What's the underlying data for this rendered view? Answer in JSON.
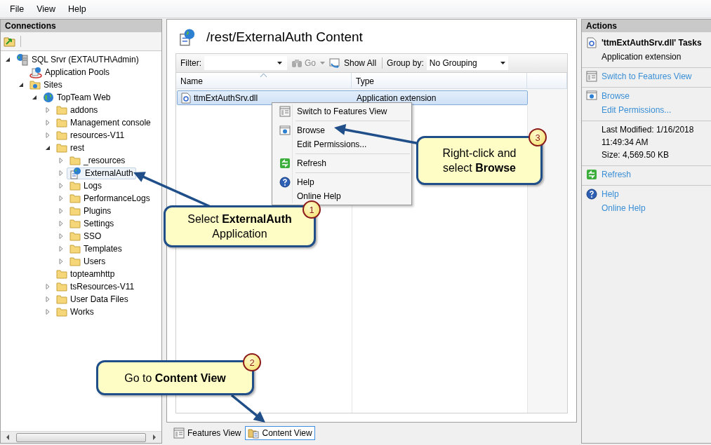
{
  "menu": [
    "File",
    "View",
    "Help"
  ],
  "connections": {
    "title": "Connections",
    "tree": [
      {
        "label": "SQL Srvr (EXTAUTH\\Admin)",
        "kind": "server",
        "expanded": true,
        "selected": false,
        "children": [
          {
            "label": "Application Pools",
            "kind": "pools",
            "selected": false
          },
          {
            "label": "Sites",
            "kind": "sites",
            "expanded": true,
            "selected": false,
            "children": [
              {
                "label": "TopTeam Web",
                "kind": "globe",
                "expanded": true,
                "selected": false,
                "children": [
                  {
                    "label": "addons",
                    "kind": "folder",
                    "expanded": false,
                    "selected": false
                  },
                  {
                    "label": "Management console",
                    "kind": "folder",
                    "expanded": false,
                    "selected": false
                  },
                  {
                    "label": "resources-V11",
                    "kind": "folder",
                    "expanded": false,
                    "selected": false
                  },
                  {
                    "label": "rest",
                    "kind": "folder",
                    "expanded": true,
                    "selected": false,
                    "children": [
                      {
                        "label": "_resources",
                        "kind": "folder",
                        "expanded": false,
                        "selected": false
                      },
                      {
                        "label": "ExternalAuth",
                        "kind": "app",
                        "expanded": false,
                        "selected": true
                      },
                      {
                        "label": "Logs",
                        "kind": "folder",
                        "expanded": false,
                        "selected": false
                      },
                      {
                        "label": "PerformanceLogs",
                        "kind": "folder",
                        "expanded": false,
                        "selected": false
                      },
                      {
                        "label": "Plugins",
                        "kind": "folder",
                        "expanded": false,
                        "selected": false
                      },
                      {
                        "label": "Settings",
                        "kind": "folder",
                        "expanded": false,
                        "selected": false
                      },
                      {
                        "label": "SSO",
                        "kind": "folder",
                        "expanded": false,
                        "selected": false
                      },
                      {
                        "label": "Templates",
                        "kind": "folder",
                        "expanded": false,
                        "selected": false
                      },
                      {
                        "label": "Users",
                        "kind": "folder",
                        "expanded": false,
                        "selected": false
                      }
                    ]
                  },
                  {
                    "label": "topteamhttp",
                    "kind": "folder",
                    "selected": false
                  },
                  {
                    "label": "tsResources-V11",
                    "kind": "folder",
                    "expanded": false,
                    "selected": false
                  },
                  {
                    "label": "User Data Files",
                    "kind": "folder",
                    "expanded": false,
                    "selected": false
                  },
                  {
                    "label": "Works",
                    "kind": "folder",
                    "expanded": false,
                    "selected": false
                  }
                ]
              }
            ]
          }
        ]
      }
    ]
  },
  "content": {
    "title": "/rest/ExternalAuth Content",
    "filter": {
      "label": "Filter:",
      "go": {
        "label": "Go",
        "disabled": true
      },
      "show_all": "Show All",
      "group_by_label": "Group by:",
      "group_by_value": "No Grouping"
    },
    "columns": [
      "Name",
      "Type"
    ],
    "rows": [
      {
        "name": "ttmExtAuthSrv.dll",
        "type": "Application extension",
        "selected": true
      }
    ],
    "view_tabs": [
      {
        "label": "Features View",
        "selected": false
      },
      {
        "label": "Content View",
        "selected": true
      }
    ]
  },
  "context_menu": [
    [
      "Switch to Features View"
    ],
    [
      "Browse",
      "Edit Permissions..."
    ],
    [
      "Refresh"
    ],
    [
      "Help",
      "Online Help"
    ]
  ],
  "actions": {
    "title": "Actions",
    "sections": [
      [
        {
          "kind": "heading",
          "text": "'ttmExtAuthSrv.dll' Tasks"
        },
        {
          "kind": "text",
          "text": "Application extension"
        }
      ],
      [
        {
          "kind": "link",
          "text": "Switch to Features View"
        }
      ],
      [
        {
          "kind": "link",
          "text": "Browse"
        },
        {
          "kind": "link",
          "text": "Edit Permissions..."
        }
      ],
      [
        {
          "kind": "text",
          "text": "Last Modified: 1/16/2018 11:49:34 AM"
        },
        {
          "kind": "text",
          "text": "Size: 4,569.50 KB"
        }
      ],
      [
        {
          "kind": "link",
          "text": "Refresh"
        }
      ],
      [
        {
          "kind": "link",
          "text": "Help"
        },
        {
          "kind": "link",
          "text": "Online Help"
        }
      ]
    ]
  },
  "callouts": [
    {
      "number": "1",
      "text": "Select **ExternalAuth** Application"
    },
    {
      "number": "2",
      "text": "Go to **Content View**"
    },
    {
      "number": "3",
      "text": "Right-click and select **Browse**"
    }
  ]
}
